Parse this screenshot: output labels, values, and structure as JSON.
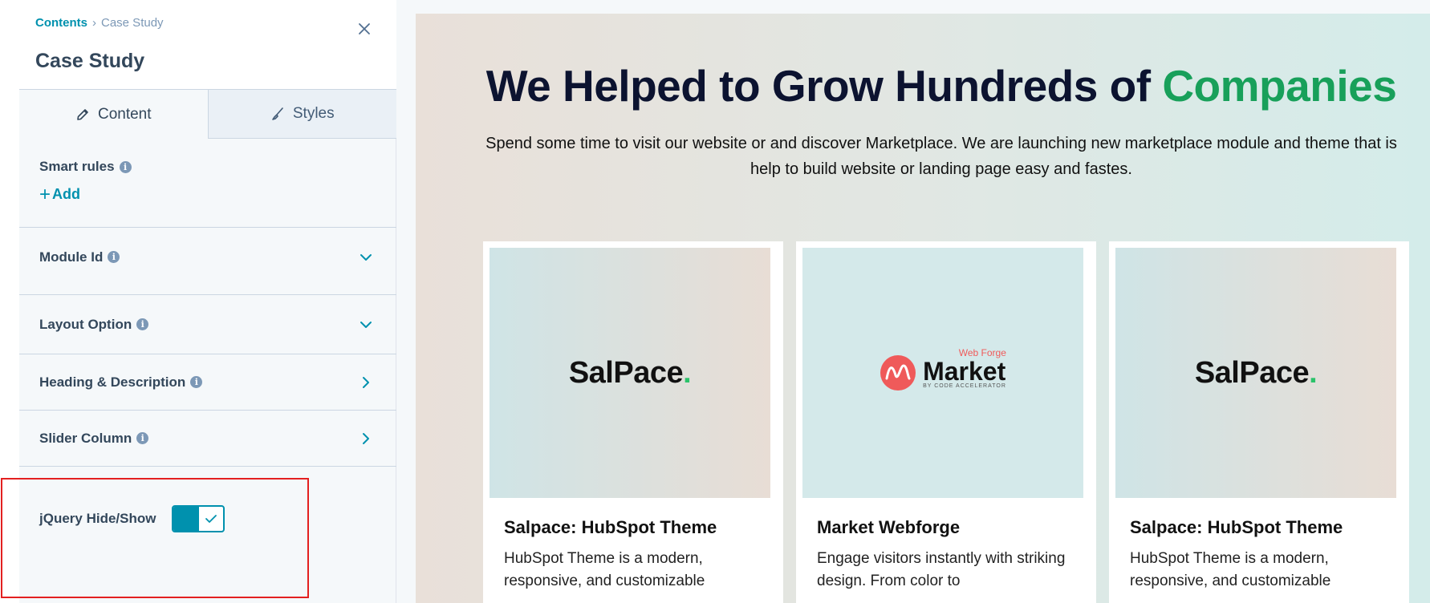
{
  "breadcrumb": {
    "parent": "Contents",
    "separator": "›",
    "current": "Case Study"
  },
  "panel": {
    "title": "Case Study"
  },
  "tabs": [
    {
      "label": "Content",
      "active": true,
      "icon": "pencil-icon"
    },
    {
      "label": "Styles",
      "active": false,
      "icon": "brush-icon"
    }
  ],
  "smart_rules": {
    "label": "Smart rules",
    "add_label": "Add"
  },
  "fields": [
    {
      "label": "Module Id",
      "state": "collapsed"
    },
    {
      "label": "Layout Option",
      "state": "collapsed"
    },
    {
      "label": "Heading & Description",
      "state": "submenu"
    },
    {
      "label": "Slider Column",
      "state": "submenu"
    }
  ],
  "toggle": {
    "label": "jQuery Hide/Show",
    "checked": true
  },
  "colors": {
    "accent": "#0091ae",
    "highlight": "#e32020",
    "title_green": "#18a05a"
  },
  "preview": {
    "heading_main": "We Helped to Grow Hundreds of ",
    "heading_accent": "Companies",
    "description": "Spend some time to visit our website or and discover Marketplace. We are launching new marketplace module and theme that is help to build website or landing page easy and fastes.",
    "cards": [
      {
        "logo_text": "SalPace",
        "logo_dot": ".",
        "title": "Salpace: HubSpot Theme",
        "text": "HubSpot Theme is a modern, responsive, and customizable"
      },
      {
        "logo_text": "Market",
        "logo_top": "Web Forge",
        "logo_sub": "BY CODE ACCELERATOR",
        "title": "Market Webforge",
        "text": "Engage visitors instantly with striking design. From color to"
      },
      {
        "logo_text": "SalPace",
        "logo_dot": ".",
        "title": "Salpace: HubSpot Theme",
        "text": "HubSpot Theme is a modern, responsive, and customizable"
      }
    ]
  }
}
